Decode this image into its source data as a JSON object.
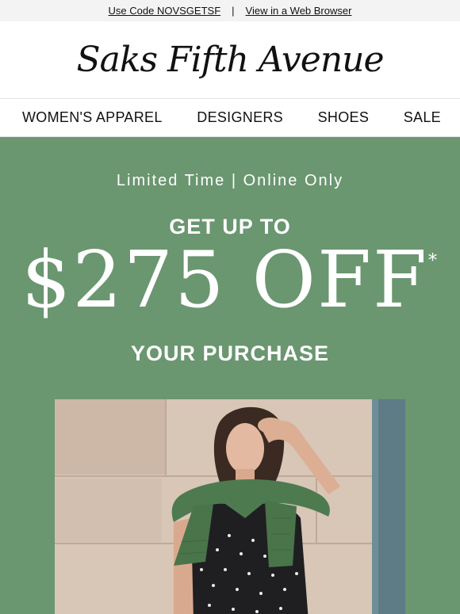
{
  "topbar": {
    "code_text": "Use Code NOVSGETSF",
    "separator": "|",
    "browser_link": "View in a Web Browser"
  },
  "brand": {
    "logo_text": "Saks Fifth Avenue"
  },
  "nav": {
    "items": [
      {
        "label": "WOMEN'S APPAREL"
      },
      {
        "label": "DESIGNERS"
      },
      {
        "label": "SHOES"
      },
      {
        "label": "SALE"
      }
    ]
  },
  "hero": {
    "subline": "Limited Time | Online Only",
    "headline_top": "GET UP TO",
    "amount": "$275 OFF",
    "asterisk": "*",
    "headline_bottom": "YOUR PURCHASE"
  },
  "colors": {
    "hero_background": "#6a9670",
    "hero_text": "#ffffff",
    "sweater": "#4e7a4f"
  }
}
